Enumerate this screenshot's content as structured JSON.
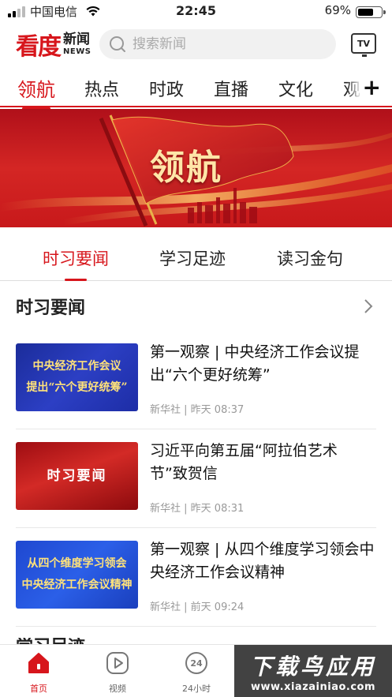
{
  "status_bar": {
    "carrier": "中国电信",
    "time": "22:45",
    "battery_pct": "69%",
    "battery_level": 0.69
  },
  "header": {
    "logo_main": "看度",
    "logo_sub": "新闻",
    "logo_en": "NEWS",
    "search_placeholder": "搜索新闻",
    "tv_label": "TV"
  },
  "channel_tabs": [
    {
      "label": "领航",
      "active": true
    },
    {
      "label": "热点",
      "active": false
    },
    {
      "label": "时政",
      "active": false
    },
    {
      "label": "直播",
      "active": false
    },
    {
      "label": "文化",
      "active": false
    },
    {
      "label": "观",
      "active": false
    }
  ],
  "add_channel": "+",
  "banner": {
    "text": "领航"
  },
  "sub_tabs": [
    {
      "label": "时习要闻",
      "active": true
    },
    {
      "label": "学习足迹",
      "active": false
    },
    {
      "label": "读习金句",
      "active": false
    }
  ],
  "section": {
    "title": "时习要闻"
  },
  "news": [
    {
      "thumb_lines": [
        "中央经济工作会议",
        "提出“六个更好统筹”"
      ],
      "title": "第一观察 | 中央经济工作会议提出“六个更好统筹”",
      "source": "新华社",
      "time": "昨天 08:37"
    },
    {
      "thumb_lines": [
        "时习要闻"
      ],
      "title": "习近平向第五届“阿拉伯艺术节”致贺信",
      "source": "新华社",
      "time": "昨天 08:31"
    },
    {
      "thumb_lines": [
        "从四个维度学习领会",
        "中央经济工作会议精神"
      ],
      "title": "第一观察 | 从四个维度学习领会中央经济工作会议精神",
      "source": "新华社",
      "time": "前天 09:24"
    }
  ],
  "next_section_title": "学习足迹",
  "bottom_nav": [
    {
      "label": "首页",
      "icon": "home-icon",
      "active": true
    },
    {
      "label": "视频",
      "icon": "video-play-icon",
      "active": false
    },
    {
      "label": "24小时",
      "icon": "24h-clock-icon",
      "active": false
    }
  ],
  "watermark": {
    "big": "下载鸟应用",
    "small": "www.xiazainiao.com"
  },
  "colors": {
    "accent": "#d7161c",
    "text": "#222222",
    "muted": "#999999"
  }
}
